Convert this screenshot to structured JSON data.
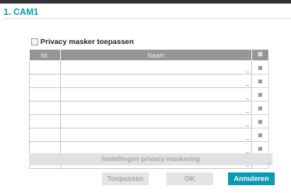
{
  "dialog": {
    "title": "1. CAM1"
  },
  "privacy": {
    "checkbox_label": "Privacy masker toepassen",
    "checked": false
  },
  "table": {
    "columns": {
      "nr": "Nr.",
      "name": "Naam"
    },
    "header_delete_icon": "close-icon",
    "rows": [
      {
        "nr": "",
        "name": ""
      },
      {
        "nr": "",
        "name": ""
      },
      {
        "nr": "",
        "name": ""
      },
      {
        "nr": "",
        "name": ""
      },
      {
        "nr": "",
        "name": ""
      },
      {
        "nr": "",
        "name": ""
      },
      {
        "nr": "",
        "name": ""
      },
      {
        "nr": "",
        "name": ""
      }
    ]
  },
  "settings_button": {
    "label": "Instellingen privacy maskering"
  },
  "buttons": {
    "apply": "Toepassen",
    "ok": "OK",
    "cancel": "Annuleren"
  },
  "colors": {
    "accent": "#0a99b3",
    "header_bg": "#969696",
    "disabled_bg": "#e4e4e4",
    "disabled_text": "#a8a8a8"
  }
}
